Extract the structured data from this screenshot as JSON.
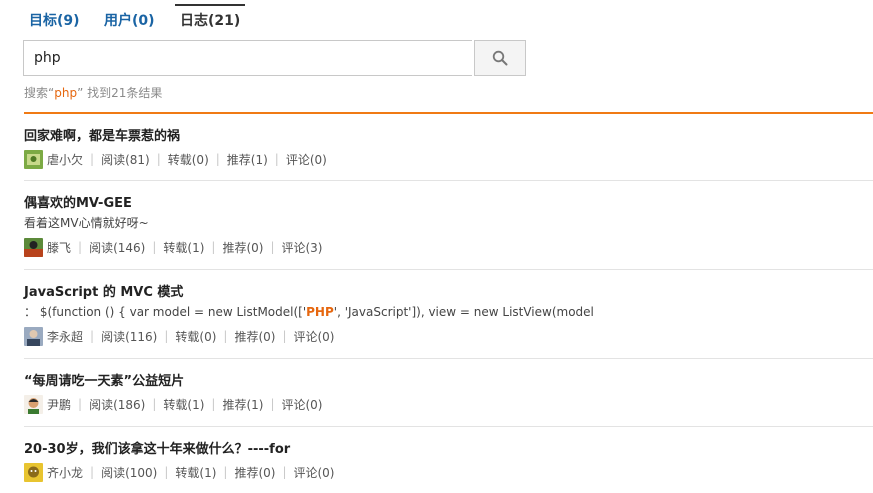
{
  "tabs": [
    {
      "label": "目标(9)"
    },
    {
      "label": "用户(0)"
    },
    {
      "label": "日志(21)"
    }
  ],
  "search": {
    "value": "php",
    "summary_prefix": "搜索“",
    "summary_keyword": "php",
    "summary_suffix": "” 找到21条结果"
  },
  "results": [
    {
      "title": "回家难啊，都是车票惹的祸",
      "author": "虐小欠",
      "read": "阅读(81)",
      "repost": "转载(0)",
      "recommend": "推荐(1)",
      "comment": "评论(0)",
      "avatar_color": "#7caa44"
    },
    {
      "title": "偶喜欢的MV-GEE",
      "desc": "看着这MV心情就好呀~",
      "author": "滕飞",
      "read": "阅读(146)",
      "repost": "转载(1)",
      "recommend": "推荐(0)",
      "comment": "评论(3)",
      "avatar_color": "#b8431c"
    },
    {
      "title": "JavaScript 的 MVC 模式",
      "desc_prefix": "：  $(function () { var model = new ListModel(['",
      "desc_highlight": "PHP",
      "desc_suffix": "', 'JavaScript']), view = new ListView(model",
      "author": "李永超",
      "read": "阅读(116)",
      "repost": "转载(0)",
      "recommend": "推荐(0)",
      "comment": "评论(0)",
      "avatar_color": "#6e7f99"
    },
    {
      "title": "“每周请吃一天素”公益短片",
      "author": "尹鹏",
      "read": "阅读(186)",
      "repost": "转载(1)",
      "recommend": "推荐(1)",
      "comment": "评论(0)",
      "avatar_color": "#d9a070"
    },
    {
      "title": "20-30岁，我们该拿这十年来做什么？----for",
      "author": "齐小龙",
      "read": "阅读(100)",
      "repost": "转载(1)",
      "recommend": "推荐(0)",
      "comment": "评论(0)",
      "avatar_color": "#8a6a1a"
    }
  ]
}
